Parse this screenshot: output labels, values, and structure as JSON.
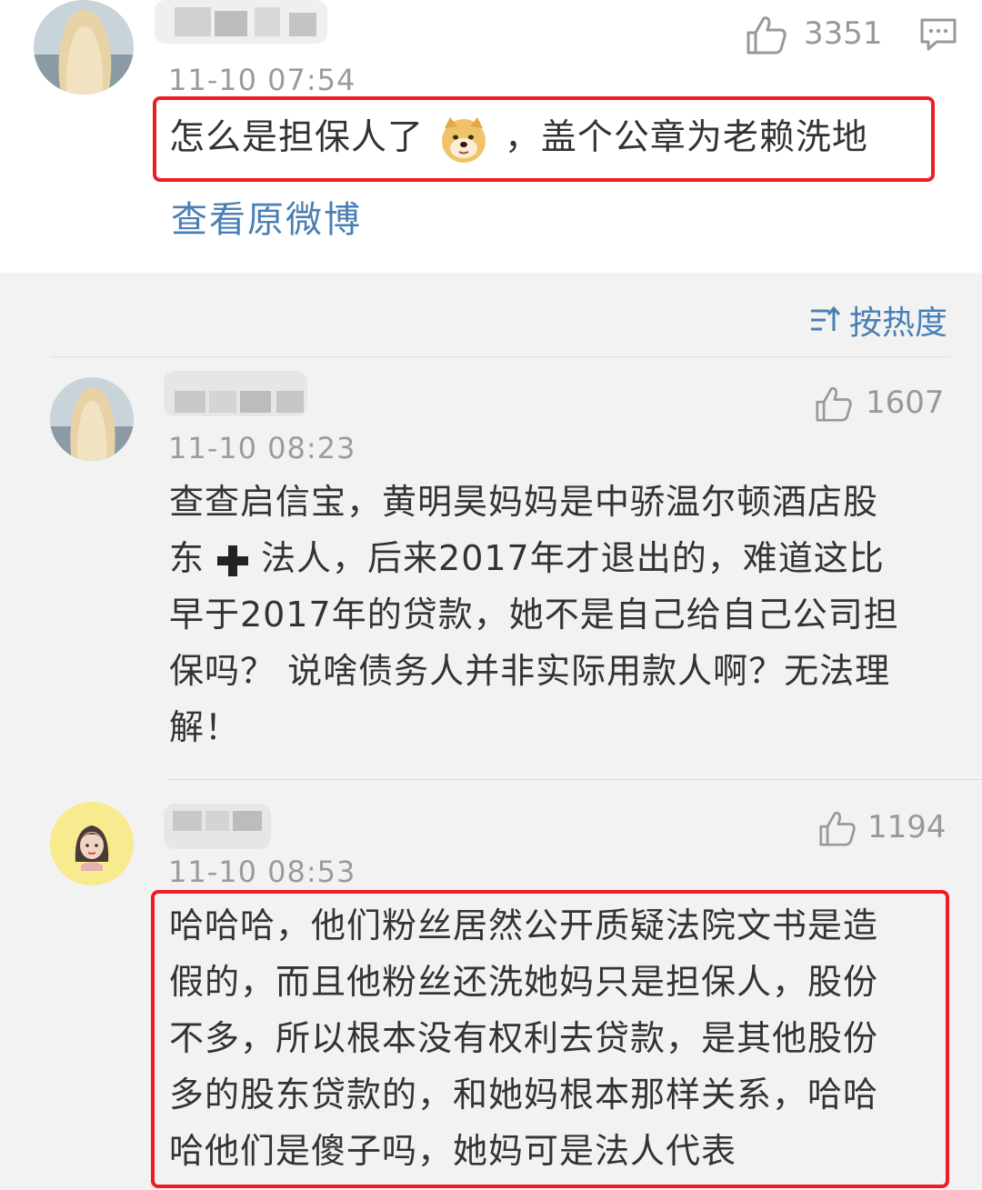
{
  "top_comment": {
    "timestamp": "11-10 07:54",
    "likes": "3351",
    "text_before_emoji": "怎么是担保人了",
    "text_after_emoji": "，盖个公章为老赖洗地",
    "emoji": "doge-emoji",
    "view_original_label": "查看原微博"
  },
  "sort": {
    "label": "按热度",
    "icon": "sort-icon"
  },
  "comments": [
    {
      "timestamp": "11-10 08:23",
      "likes": "1607",
      "line1": "查查启信宝，黄明昊妈妈是中骄温尔顿酒店股",
      "line2_a": "东",
      "line2_b": "法人，后来2017年才退出的，难道这比",
      "line3": "早于2017年的贷款，她不是自己给自己公司担",
      "line4": "保吗？ 说啥债务人并非实际用款人啊？无法理",
      "line5": "解！"
    },
    {
      "timestamp": "11-10 08:53",
      "likes": "1194",
      "line1": "哈哈哈，他们粉丝居然公开质疑法院文书是造",
      "line2": "假的，而且他粉丝还洗她妈只是担保人，股份",
      "line3": "不多，所以根本没有权利去贷款，是其他股份",
      "line4": "多的股东贷款的，和她妈根本那样关系，哈哈",
      "line5": "哈他们是傻子吗，她妈可是法人代表"
    }
  ],
  "colors": {
    "highlight_red": "#ee1d23",
    "link_blue": "#4a7fb5",
    "timestamp_gray": "#9b9b9b",
    "lower_background": "#f2f2f2"
  }
}
